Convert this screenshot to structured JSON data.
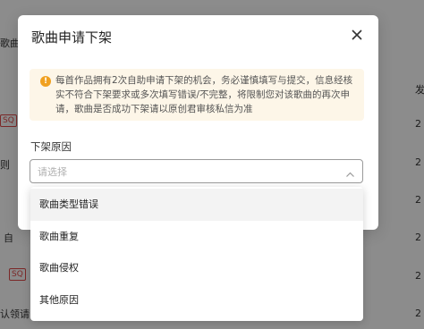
{
  "background": {
    "left_fragments": [
      "歌曲",
      "SQ",
      "则",
      "自",
      "SQ",
      "认领请"
    ],
    "right_fragments": [
      "发",
      "2",
      "2",
      "2",
      "2",
      "2",
      "2",
      "2"
    ]
  },
  "modal": {
    "title": "歌曲申请下架",
    "close_icon": "close-icon",
    "notice": {
      "icon": "info-icon",
      "text": "每首作品拥有2次自助申请下架的机会，务必谨慎填写与提交，信息经核实不符合下架要求或多次填写错误/不完整，将限制您对该歌曲的再次申请，歌曲是否成功下架请以原创君审核私信为准"
    },
    "reason_label": "下架原因",
    "select": {
      "placeholder": "请选择",
      "chevron_icon": "chevron-up-icon"
    }
  },
  "dropdown": {
    "options": [
      "歌曲类型错误",
      "歌曲重复",
      "歌曲侵权",
      "其他原因"
    ],
    "hovered_index": 0
  }
}
